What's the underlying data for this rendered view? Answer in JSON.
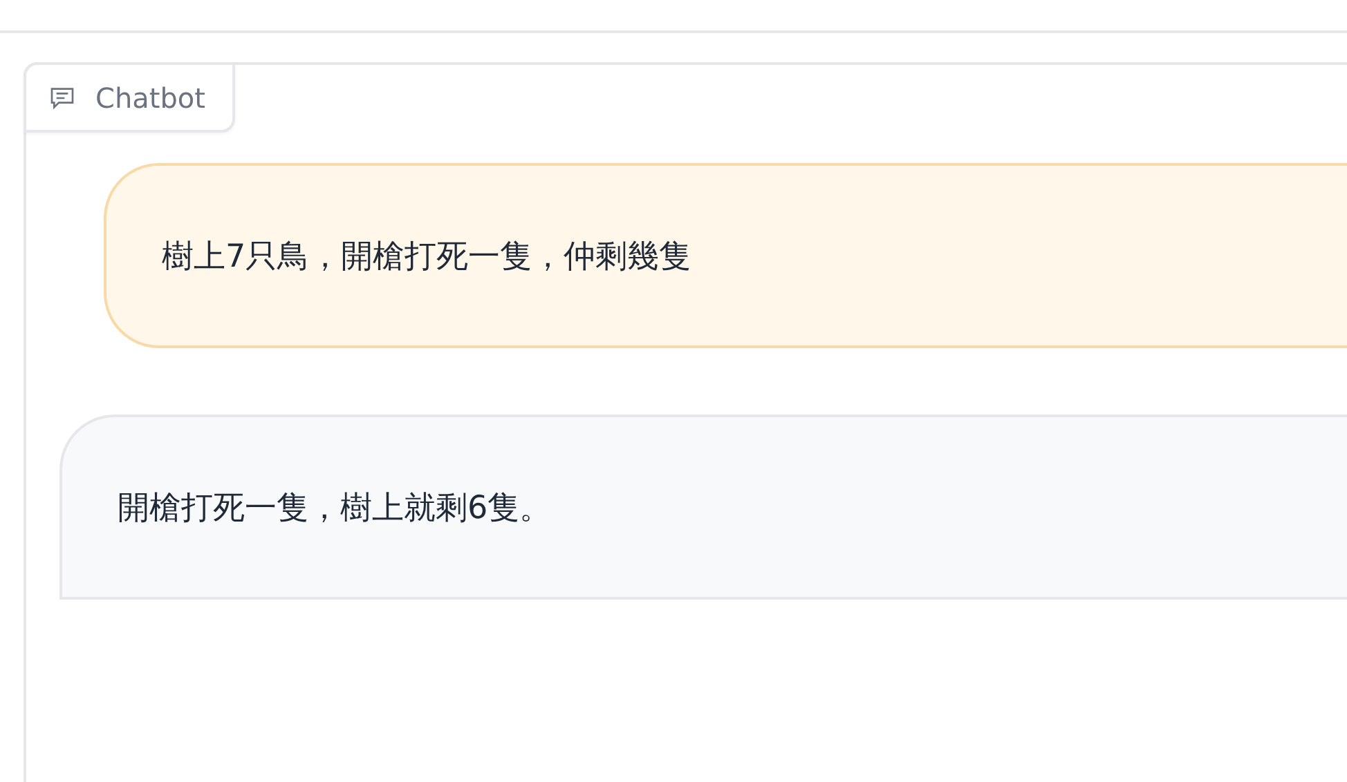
{
  "chatbot": {
    "label": "Chatbot",
    "messages": [
      {
        "kind": "user",
        "text": "樹上7只鳥，開槍打死一隻，仲剩幾隻"
      },
      {
        "kind": "bot",
        "text": "開槍打死一隻，樹上就剩6隻。"
      }
    ]
  }
}
